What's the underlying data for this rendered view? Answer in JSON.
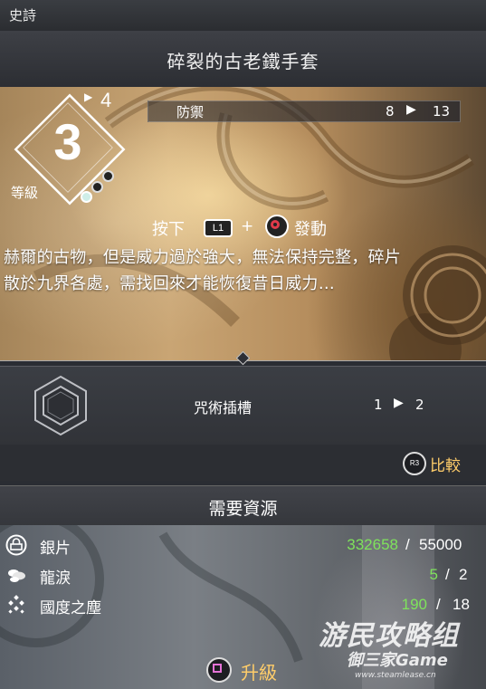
{
  "rarity": "史詩",
  "item_name": "碎裂的古老鐵手套",
  "level": {
    "label": "等級",
    "current": "3",
    "max": "4",
    "pips_filled": 1,
    "pips_total": 3
  },
  "stat": {
    "name": "防禦",
    "from": "8",
    "to": "13"
  },
  "activate": {
    "press": "按下",
    "l1": "L1",
    "plus": "+",
    "action": "發動"
  },
  "description": {
    "line1": "赫爾的古物，但是威力過於強大，無法保持完整，碎片",
    "line2": "散於九界各處，需找回來才能恢復昔日威力…"
  },
  "slot": {
    "name": "咒術插槽",
    "from": "1",
    "to": "2"
  },
  "compare": {
    "button": "R3",
    "label": "比較"
  },
  "resources": {
    "title": "需要資源",
    "items": [
      {
        "icon": "silver-icon",
        "name": "銀片",
        "have": "332658",
        "sep": "/",
        "need": "55000"
      },
      {
        "icon": "dragon-tear-icon",
        "name": "龍淚",
        "have": "5",
        "sep": "/",
        "need": "2"
      },
      {
        "icon": "realm-dust-icon",
        "name": "國度之塵",
        "have": "190",
        "sep": "/",
        "need": "18"
      }
    ]
  },
  "upgrade": {
    "label": "升級"
  },
  "watermark": {
    "top": "游民攻略组",
    "mid": "御三家Game",
    "url": "www.steamlease.cn"
  },
  "colors": {
    "accent_gold": "#ffcd6a",
    "have_green": "#7fe35c",
    "circle_red": "#e03a4a",
    "square_pink": "#e472d6"
  }
}
